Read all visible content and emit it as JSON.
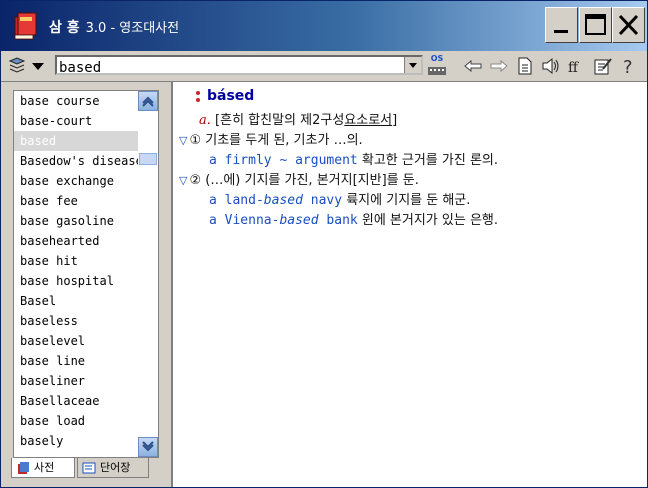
{
  "window": {
    "title": "삼 흥",
    "version": "3.0 - 영조대사전"
  },
  "toolbar": {
    "search_value": "based",
    "os_label": "OS"
  },
  "word_list": [
    "base course",
    "base-court",
    "based",
    "Basedow's disease",
    "base exchange",
    "base fee",
    "base gasoline",
    "basehearted",
    "base hit",
    "base hospital",
    "Basel",
    "baseless",
    "baselevel",
    "base line",
    "baseliner",
    "Basellaceae",
    "base load",
    "basely"
  ],
  "selected_index": 2,
  "tabs": [
    "사전",
    "단어장"
  ],
  "entry": {
    "headword": "básed",
    "pos": "a.",
    "pos_note": "[흔히 합친말의 제2구성",
    "pos_note_underlined": "요소로서",
    "pos_note_end": "]",
    "senses": [
      {
        "number": "①",
        "definition": "기초를 두게 된, 기초가 …의.",
        "example_pre": "a ",
        "example_en1": "firmly",
        "example_tilde": " ~ ",
        "example_en2": "argument",
        "example_ko": "확고한 근거를 가진 론의."
      },
      {
        "number": "②",
        "definition": "(…에) 기지를 가진, 본거지[지반]를 둔.",
        "ex1_pre": "a land-",
        "ex1_em": "based",
        "ex1_post": " navy",
        "ex1_ko": "륙지에 기지를 둔 해군.",
        "ex2_pre": "a Vienna-",
        "ex2_em": "based",
        "ex2_post": " bank",
        "ex2_ko": "윈에 본거지가 있는 은행."
      }
    ]
  }
}
